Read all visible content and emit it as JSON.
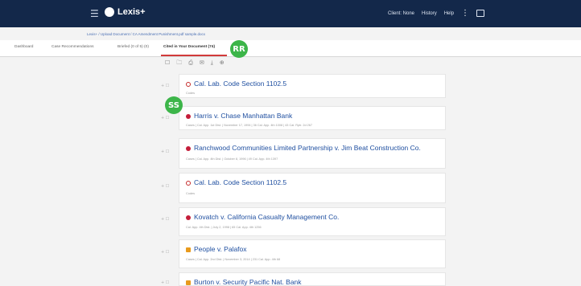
{
  "topbar": {
    "menu_icon": "hamburger-icon",
    "logo_text": "Lexis+",
    "client": "Client: None",
    "history": "History",
    "help": "Help",
    "kebab_icon": "kebab-icon",
    "chat_icon": "chat-icon"
  },
  "breadcrumb": "Lexis+ / Upload Document / CA Amendment Punishment.pdf sample.docx",
  "tabs": [
    {
      "label": "Dashboard"
    },
    {
      "label": "Case Recommendations"
    },
    {
      "label": "Briefed (0 of 5) (0)"
    },
    {
      "label": "Cited in Your Document (74)"
    }
  ],
  "badges": {
    "rr": "RR",
    "ss": "SS"
  },
  "toolbar_icons": [
    "checkbox-icon",
    "folder-icon",
    "print-icon",
    "email-icon",
    "download-icon",
    "link-icon"
  ],
  "results": [
    {
      "title": "Cal. Lab. Code Section 1102.5",
      "meta": "Codes",
      "marker": "ring"
    },
    {
      "title": "Harris v. Chase Manhattan Bank",
      "meta": "Cases | Cal. App. 1st Dist. | November 17, 1994 | 36 Cal. App. 4th 1008 | 43 Cal. Rptr. 2d 267",
      "marker": "dot"
    },
    {
      "title": "Ranchwood Communities Limited Partnership v. Jim Beat Construction Co.",
      "meta": "Cases | Cal. App. 4th Dist. | October 8, 1996 | 49 Cal. App. 4th 1397",
      "marker": "dot"
    },
    {
      "title": "Cal. Lab. Code Section 1102.5",
      "meta": "Codes",
      "marker": "ring"
    },
    {
      "title": "Kovatch v. California Casualty Management Co.",
      "meta": "Cal. App. 4th Dist. | July 2, 1998 | 65 Cal. App. 4th 1256",
      "marker": "dot"
    },
    {
      "title": "People v. Palafox",
      "meta": "Cases | Cal. App. 2nd Dist. | November 3, 2014 | 231 Cal. App. 4th 68",
      "marker": "sq"
    },
    {
      "title": "Burton v. Security Pacific Nat. Bank",
      "meta": "",
      "marker": "sq"
    }
  ]
}
